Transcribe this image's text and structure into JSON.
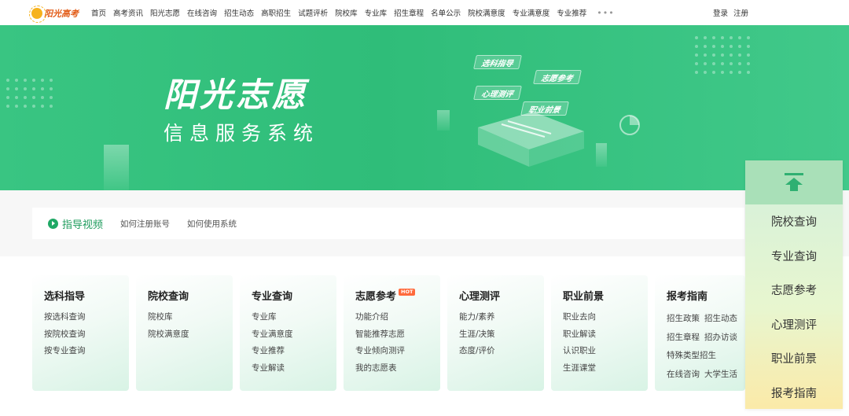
{
  "logo": {
    "text": "阳光高考"
  },
  "nav": {
    "items": [
      "首页",
      "高考资讯",
      "阳光志愿",
      "在线咨询",
      "招生动态",
      "高职招生",
      "试题评析",
      "院校库",
      "专业库",
      "招生章程",
      "名单公示",
      "院校满意度",
      "专业满意度",
      "专业推荐"
    ],
    "more": "•••",
    "login": "登录",
    "register": "注册"
  },
  "banner": {
    "title": "阳光志愿",
    "subtitle": "信息服务系统",
    "tags": [
      "选科指导",
      "志愿参考",
      "心理测评",
      "职业前景"
    ]
  },
  "guide": {
    "title": "指导视频",
    "links": [
      "如何注册账号",
      "如何使用系统"
    ]
  },
  "cards": [
    {
      "title": "选科指导",
      "links": [
        "按选科查询",
        "按院校查询",
        "按专业查询"
      ]
    },
    {
      "title": "院校查询",
      "links": [
        "院校库",
        "院校满意度"
      ]
    },
    {
      "title": "专业查询",
      "links": [
        "专业库",
        "专业满意度",
        "专业推荐",
        "专业解读"
      ]
    },
    {
      "title": "志愿参考",
      "badge": "HOT",
      "links": [
        "功能介绍",
        "智能推荐志愿",
        "专业倾向测评",
        "我的志愿表"
      ]
    },
    {
      "title": "心理测评",
      "links": [
        "能力/素养",
        "生涯/决策",
        "态度/评价"
      ]
    },
    {
      "title": "职业前景",
      "links": [
        "职业去向",
        "职业解读",
        "认识职业",
        "生涯课堂"
      ]
    },
    {
      "title": "报考指南",
      "links": [
        "招生政策",
        "招生动态",
        "招生章程",
        "招办访谈",
        "特殊类型招生",
        "在线咨询",
        "大学生活"
      ]
    }
  ],
  "side": {
    "items": [
      "院校查询",
      "专业查询",
      "志愿参考",
      "心理测评",
      "职业前景",
      "报考指南"
    ]
  },
  "colors": {
    "brand_green": "#2fbd79",
    "hot_badge": "#ff6a3c",
    "logo_orange": "#e25b16"
  }
}
